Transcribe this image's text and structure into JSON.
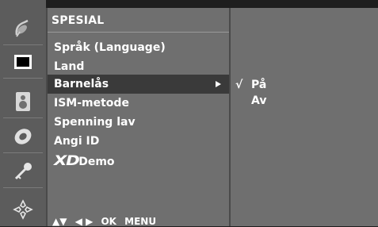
{
  "menu": {
    "title": "SPESIAL",
    "items": [
      {
        "label": "Språk (Language)",
        "selected": false
      },
      {
        "label": "Land",
        "selected": false
      },
      {
        "label": "Barnelås",
        "selected": true
      },
      {
        "label": "ISM-metode",
        "selected": false
      },
      {
        "label": "Spenning lav",
        "selected": false
      },
      {
        "label": "Angi ID",
        "selected": false
      },
      {
        "label": "Demo",
        "logo": "XD",
        "selected": false
      }
    ],
    "footer": {
      "nav_up_down": "▲▼",
      "nav_left_right": "◀ ▶",
      "ok": "OK",
      "menu": "MENU"
    }
  },
  "submenu": {
    "options": [
      {
        "label": "På",
        "checked": true,
        "check_mark": "√"
      },
      {
        "label": "Av",
        "checked": false,
        "check_mark": ""
      }
    ]
  },
  "icons": [
    "satellite-dish-icon",
    "picture-icon",
    "speaker-icon",
    "disc-icon",
    "key-icon",
    "option-cross-icon"
  ],
  "colors": {
    "panel_gray": "#6f6f6f",
    "selected_row": "#3a3a3a",
    "icon_column": "#5c5c5c",
    "text": "#ffffff"
  }
}
